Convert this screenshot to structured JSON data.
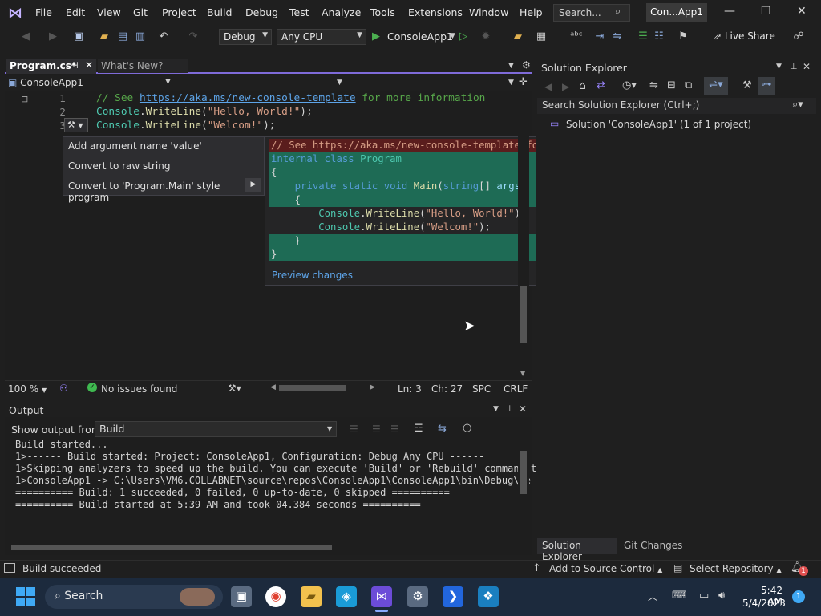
{
  "menubar": {
    "items": [
      "File",
      "Edit",
      "View",
      "Git",
      "Project",
      "Build",
      "Debug",
      "Test",
      "Analyze",
      "Tools",
      "Extensions",
      "Window",
      "Help"
    ],
    "search_label": "Search...",
    "solution_badge": "Con...App1"
  },
  "toolbar": {
    "config": "Debug",
    "platform": "Any CPU",
    "start_label": "ConsoleApp1",
    "live_share": "Live Share"
  },
  "doc_tabs": {
    "active": "Program.cs*",
    "inactive": "What's New?"
  },
  "nav": {
    "project": "ConsoleApp1"
  },
  "code": {
    "line_numbers": [
      "1",
      "2",
      "3"
    ],
    "line1_comment": "// See ",
    "line1_link": "https://aka.ms/new-console-template",
    "line1_rest": " for more information",
    "line2_type": "Console",
    "line2_dot": ".",
    "line2_method": "WriteLine",
    "line2_open": "(",
    "line2_string": "\"Hello, World!\"",
    "line2_close": ");",
    "line3_type": "Console",
    "line3_dot": ".",
    "line3_method": "WriteLine",
    "line3_open": "(",
    "line3_string": "\"Welcom!\"",
    "line3_close": ");"
  },
  "quick_actions": {
    "items": [
      "Add argument name 'value'",
      "Convert to raw string",
      "Convert to 'Program.Main' style program"
    ],
    "preview": {
      "removed": "// See https://aka.ms/new-console-template for more information",
      "l_internal": "internal",
      "l_class": "class",
      "l_program": "Program",
      "brace_open": "{",
      "l_private": "private",
      "l_static": "static",
      "l_void": "void",
      "l_main": "Main",
      "l_paren_open": "(",
      "l_string_kw": "string",
      "l_brackets": "[] ",
      "l_args": "args",
      "l_paren_close": ")",
      "inner_brace_open": "{",
      "p_type": "Console",
      "p_dot": ".",
      "p_method": "WriteLine",
      "p_open": "(",
      "p_hello": "\"Hello, World!\"",
      "p_welcom": "\"Welcom!\"",
      "p_close": ");",
      "inner_brace_close": "}",
      "brace_close": "}"
    },
    "preview_link": "Preview changes"
  },
  "editor_status": {
    "zoom": "100 %",
    "issues": "No issues found",
    "line": "Ln: 3",
    "char": "Ch: 27",
    "spc": "SPC",
    "eol": "CRLF"
  },
  "output": {
    "title": "Output",
    "show_from_label": "Show output from:",
    "source": "Build",
    "lines": [
      "Build started...",
      "1>------ Build started: Project: ConsoleApp1, Configuration: Debug Any CPU ------",
      "1>Skipping analyzers to speed up the build. You can execute 'Build' or 'Rebuild' command t",
      "1>ConsoleApp1 -> C:\\Users\\VM6.COLLABNET\\source\\repos\\ConsoleApp1\\ConsoleApp1\\bin\\Debug\\ne",
      "========== Build: 1 succeeded, 0 failed, 0 up-to-date, 0 skipped ==========",
      "========== Build started at 5:39 AM and took 04.384 seconds =========="
    ]
  },
  "solution_explorer": {
    "title": "Solution Explorer",
    "search_placeholder": "Search Solution Explorer (Ctrl+;)",
    "solution_item": "Solution 'ConsoleApp1' (1 of 1 project)",
    "tab_solution": "Solution Explorer",
    "tab_git": "Git Changes"
  },
  "statusbar": {
    "message": "Build succeeded",
    "source_control": "Add to Source Control",
    "repository": "Select Repository",
    "notification_count": "1"
  },
  "taskbar": {
    "search": "Search",
    "time": "5:42 AM",
    "date": "5/4/2023",
    "badge": "1"
  },
  "colors": {
    "accent": "#7f6bd9",
    "add_bg": "#1e6b55",
    "del_bg": "#5a1d1d",
    "taskbar": "#1c2a3d"
  }
}
